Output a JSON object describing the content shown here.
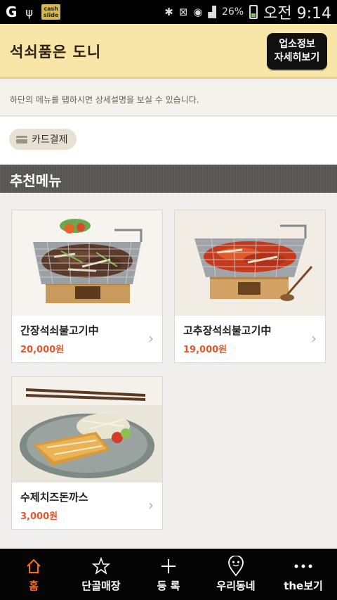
{
  "status_bar": {
    "left_icons": [
      "g-icon",
      "usb-icon",
      "cashslide-icon"
    ],
    "cashslide_label_1": "cash",
    "cashslide_label_2": "slide",
    "battery_percent": "26%",
    "time": "오전 9:14"
  },
  "header": {
    "store_name": "석쇠품은 도니",
    "info_button_line1": "업소정보",
    "info_button_line2": "자세히보기",
    "background": "#f8e6a8"
  },
  "notice": {
    "text": "하단의 메뉴를 탭하시면 상세설명을 보실 수 있습니다."
  },
  "payment": {
    "label": "카드결제"
  },
  "section": {
    "title": "추천메뉴"
  },
  "menu_items": [
    {
      "name": "간장석쇠불고기中",
      "price": "20,000원"
    },
    {
      "name": "고추장석쇠불고기中",
      "price": "19,000원"
    },
    {
      "name": "수제치즈돈까스",
      "price": "3,000원"
    }
  ],
  "bottom_nav": [
    {
      "label": "홈",
      "icon": "home-icon",
      "active": true
    },
    {
      "label": "단골매장",
      "icon": "star-icon",
      "active": false
    },
    {
      "label": "등 록",
      "icon": "plus-icon",
      "active": false
    },
    {
      "label": "우리동네",
      "icon": "map-pin-icon",
      "active": false
    },
    {
      "label": "the보기",
      "icon": "more-dots-icon",
      "active": false
    }
  ],
  "colors": {
    "accent": "#ff6c1a",
    "price": "#e3572a"
  }
}
